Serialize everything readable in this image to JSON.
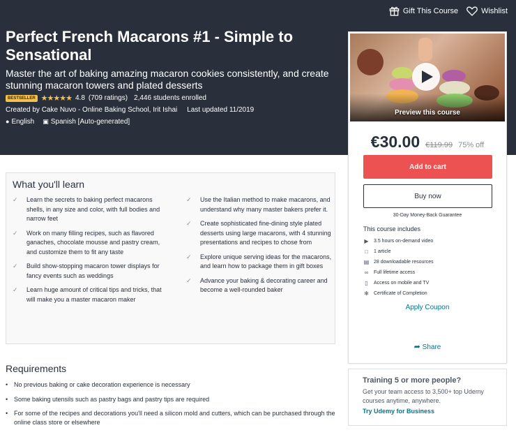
{
  "topbar": {
    "gift_label": "Gift This Course",
    "wishlist_label": "Wishlist"
  },
  "course": {
    "title": "Perfect French Macarons #1 - Simple to Sensational",
    "subtitle": "Master the art of baking amazing macaron cookies consistently, and create stunning macaron towers and plated desserts",
    "badge": "BESTSELLER",
    "stars": "★★★★★",
    "rating": "4.8",
    "ratings_count": "(709 ratings)",
    "students": "2,446 students enrolled",
    "created_by": "Created by Cake Nuvo - Online Baking School, Irit Ishai",
    "last_updated": "Last updated 11/2019",
    "language": "English",
    "captions": "Spanish [Auto-generated]"
  },
  "card": {
    "preview_label": "Preview this course",
    "price": "€30.00",
    "original_price": "€119.99",
    "discount": "75% off",
    "add_to_cart": "Add to cart",
    "buy_now": "Buy now",
    "guarantee": "30-Day Money-Back Guarantee",
    "includes_title": "This course includes",
    "includes": [
      {
        "icon": "video-icon",
        "text": "3.5 hours on-demand video"
      },
      {
        "icon": "article-icon",
        "text": "1 article"
      },
      {
        "icon": "resources-icon",
        "text": "28 downloadable resources"
      },
      {
        "icon": "infinity-icon",
        "text": "Full lifetime access"
      },
      {
        "icon": "mobile-icon",
        "text": "Access on mobile and TV"
      },
      {
        "icon": "certificate-icon",
        "text": "Certificate of Completion"
      }
    ],
    "coupon": "Apply Coupon",
    "share": "Share"
  },
  "business": {
    "title": "Training 5 or more people?",
    "description": "Get your team access to 3,500+ top Udemy courses anytime, anywhere.",
    "link": "Try Udemy for Business"
  },
  "learn": {
    "title": "What you'll learn",
    "left": [
      "Learn the secrets to baking perfect macarons shells, in any size and color, with full bodies and narrow feet",
      "Work on many filling recipes, such as flavored ganaches, chocolate mousse and pastry cream, and customize them to fit any taste",
      "Build show-stopping macaron tower displays for fancy events such as weddings",
      "Learn huge amount of critical tips and tricks, that will make you a master macaron maker"
    ],
    "right": [
      "Use the Italian method to make macarons, and understand why many master bakers prefer it.",
      "Create sophisticated fine-dining style plated desserts using large macarons, with 4 stunning presentations and recipes to chose from",
      "Explore unique serving ideas for the macarons, and learn how to package them in gift boxes",
      "Advance your baking & decorating career and become a well-rounded baker"
    ]
  },
  "requirements": {
    "title": "Requirements",
    "items": [
      "No previous baking or cake decoration experience is necessary",
      "Some baking utensils such as pastry bags and pastry tips are required",
      "For some of the recipes and decorations you'll need a silicon mold and cutters, which can be purchased through the online class store or elsewhere"
    ]
  },
  "colors": {
    "hero_bg": "#29303b",
    "accent_red": "#ec5252",
    "link_blue": "#007791",
    "star_gold": "#f4c150"
  }
}
